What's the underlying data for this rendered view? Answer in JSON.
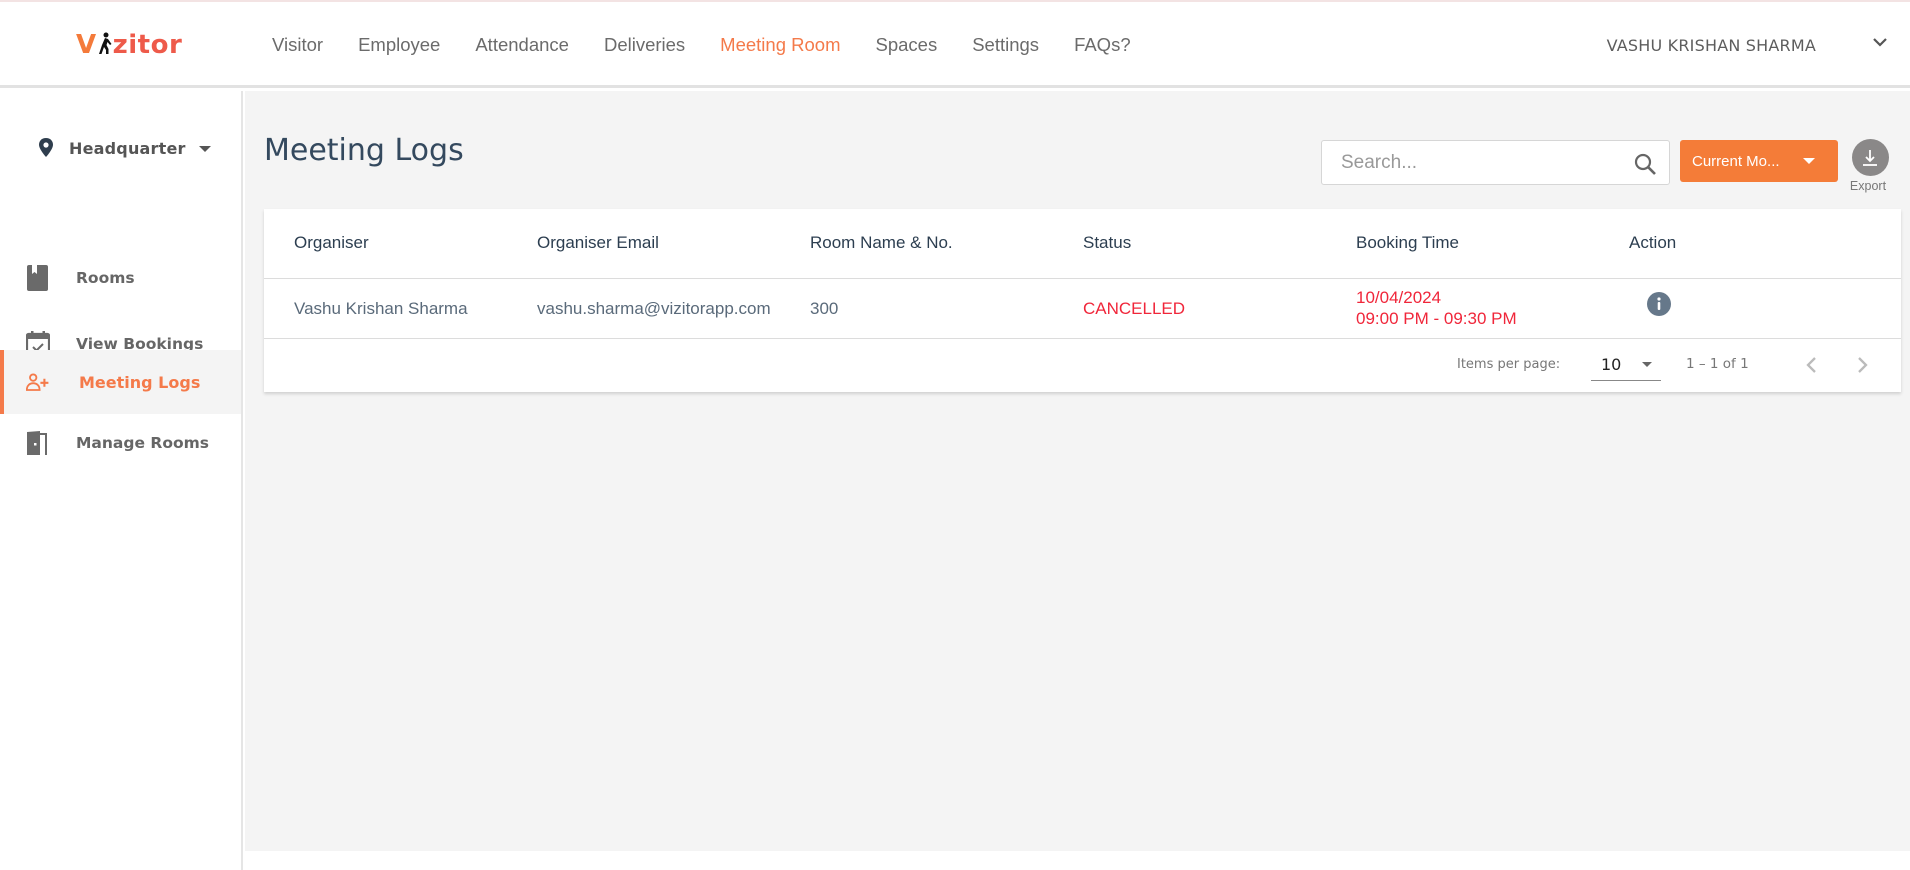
{
  "app": {
    "logo": {
      "first": "V",
      "rest": "zitor"
    },
    "brand_color": "#f47a3a"
  },
  "nav": {
    "items": [
      {
        "label": "Visitor",
        "active": false
      },
      {
        "label": "Employee",
        "active": false
      },
      {
        "label": "Attendance",
        "active": false
      },
      {
        "label": "Deliveries",
        "active": false
      },
      {
        "label": "Meeting Room",
        "active": true
      },
      {
        "label": "Spaces",
        "active": false
      },
      {
        "label": "Settings",
        "active": false
      },
      {
        "label": "FAQs?",
        "active": false
      }
    ]
  },
  "user": {
    "name": "VASHU KRISHAN SHARMA",
    "menu_icon": "chevron-down-icon"
  },
  "sidebar": {
    "location": {
      "label": "Headquarter",
      "icon": "location-pin-icon"
    },
    "items": [
      {
        "label": "Rooms",
        "icon": "book-icon",
        "active": false
      },
      {
        "label": "View Bookings",
        "icon": "calendar-check-icon",
        "active": false
      },
      {
        "label": "Meeting Logs",
        "icon": "person-add-icon",
        "active": true
      },
      {
        "label": "Manage Rooms",
        "icon": "door-icon",
        "active": false
      }
    ]
  },
  "page": {
    "title": "Meeting Logs",
    "search": {
      "placeholder": "Search...",
      "value": ""
    },
    "filter": {
      "selected": "Current Mo..."
    },
    "export": {
      "label": "Export"
    }
  },
  "table": {
    "columns": [
      "Organiser",
      "Organiser Email",
      "Room Name & No.",
      "Status",
      "Booking Time",
      "Action"
    ],
    "rows": [
      {
        "organiser": "Vashu Krishan Sharma",
        "email": "vashu.sharma@vizitorapp.com",
        "room": "300",
        "status": "CANCELLED",
        "booking_date": "10/04/2024",
        "booking_time": "09:00 PM - 09:30 PM",
        "action_icon": "info-icon"
      }
    ],
    "status_color": "#f0263a"
  },
  "pagination": {
    "items_per_page_label": "Items per page:",
    "items_per_page": "10",
    "range": "1 – 1 of 1"
  }
}
